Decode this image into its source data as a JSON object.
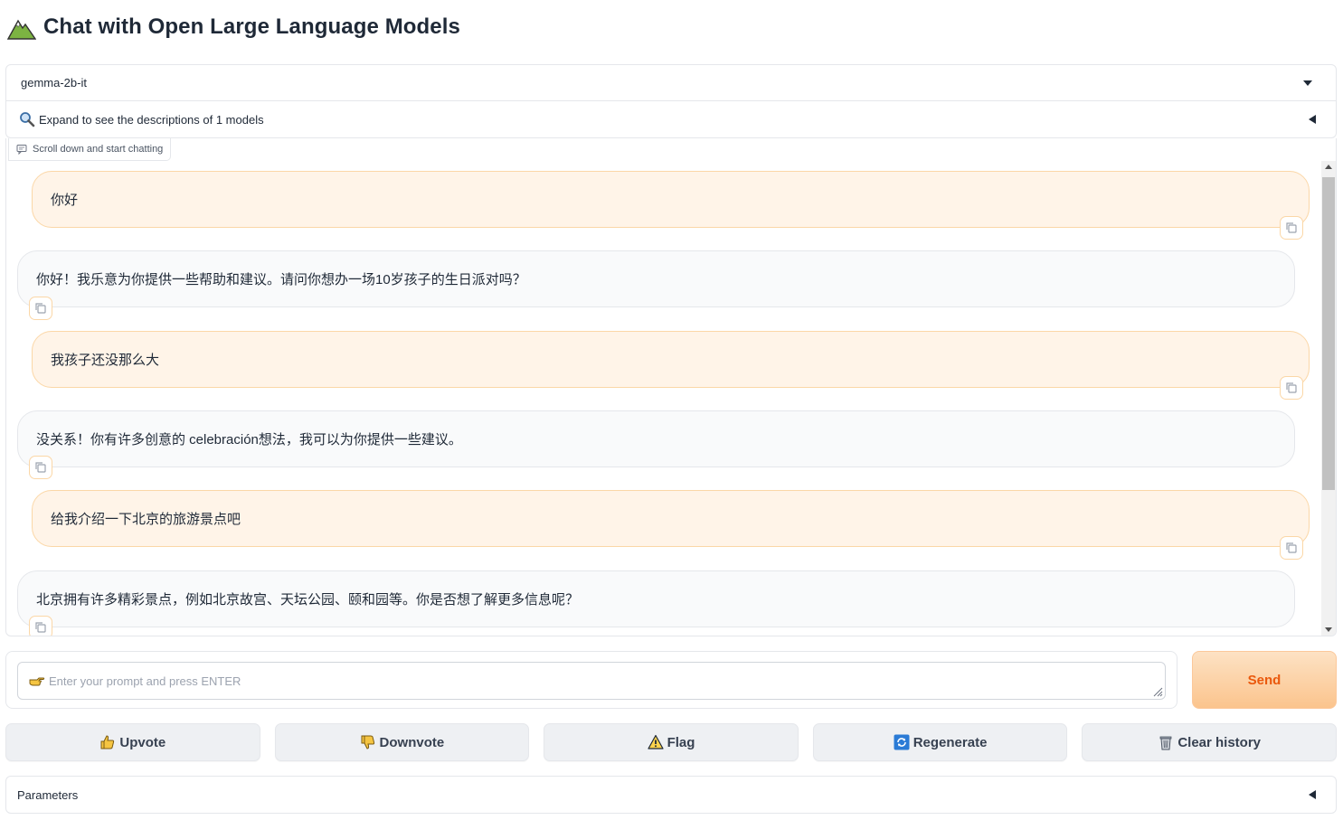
{
  "header": {
    "title": "Chat with Open Large Language Models",
    "logo_icon": "mountain-icon"
  },
  "model_selector": {
    "selected": "gemma-2b-it"
  },
  "descriptions_accordion": {
    "label": "Expand to see the descriptions of 1 models",
    "icon": "magnifier-icon"
  },
  "chatbot": {
    "label": "Scroll down and start chatting",
    "messages": [
      {
        "role": "user",
        "text": "你好"
      },
      {
        "role": "bot",
        "text": "你好！我乐意为你提供一些帮助和建议。请问你想办一场10岁孩子的生日派对吗？"
      },
      {
        "role": "user",
        "text": "我孩子还没那么大"
      },
      {
        "role": "bot",
        "text": "没关系！你有许多创意的 celebración想法，我可以为你提供一些建议。"
      },
      {
        "role": "user",
        "text": "给我介绍一下北京的旅游景点吧"
      },
      {
        "role": "bot",
        "text": "北京拥有许多精彩景点，例如北京故宫、天坛公园、颐和园等。你是否想了解更多信息呢？"
      }
    ]
  },
  "prompt": {
    "placeholder": "Enter your prompt and press ENTER",
    "value": ""
  },
  "send_button": {
    "label": "Send"
  },
  "actions": {
    "upvote": "Upvote",
    "downvote": "Downvote",
    "flag": "Flag",
    "regenerate": "Regenerate",
    "clear_history": "Clear history"
  },
  "parameters": {
    "label": "Parameters"
  },
  "colors": {
    "accent": "#ea580c",
    "user_bubble": "#fff4e8",
    "bot_bubble": "#f9fafb"
  }
}
